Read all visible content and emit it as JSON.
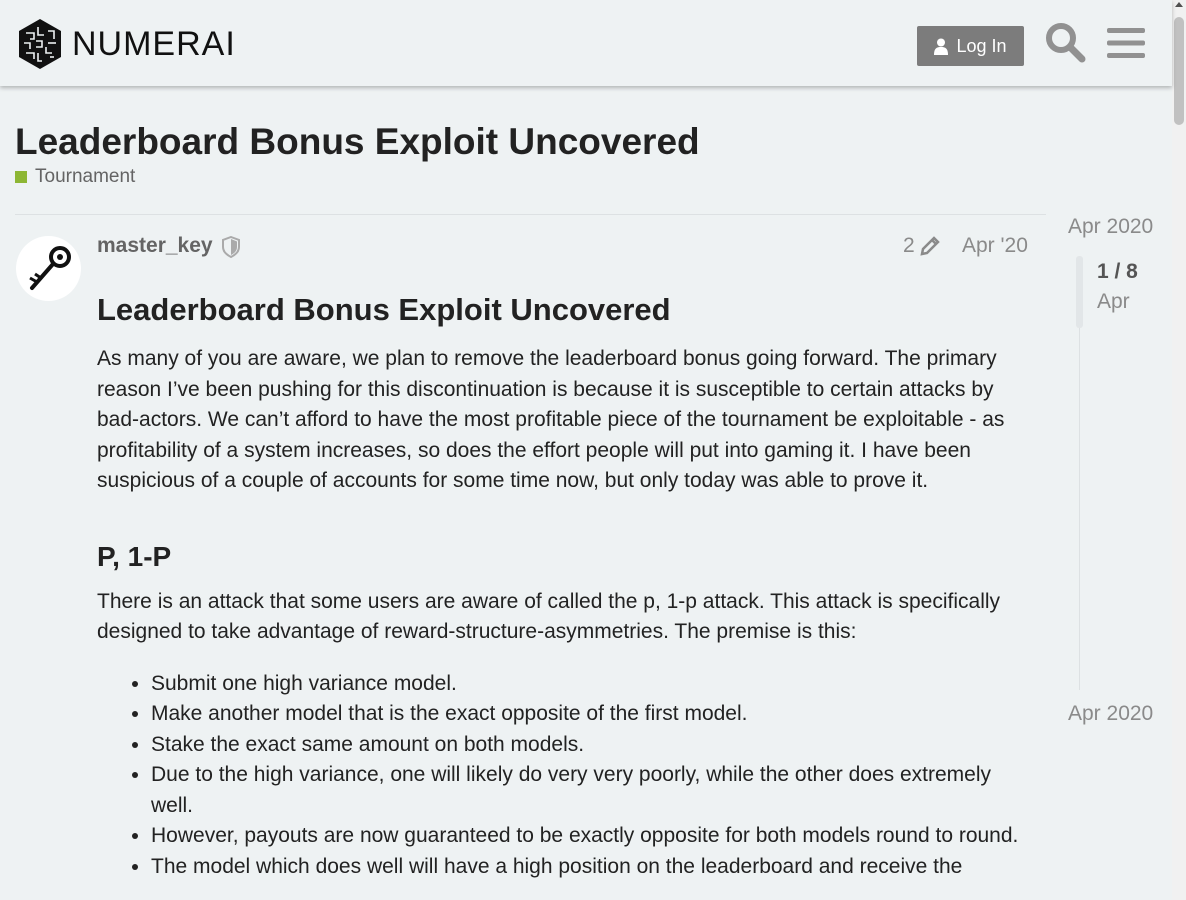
{
  "header": {
    "logo_text": "NUMERAI",
    "login_label": "Log In",
    "icons": [
      "numerai-logo-icon",
      "user-icon",
      "search-icon",
      "hamburger-menu-icon"
    ]
  },
  "topic": {
    "title": "Leaderboard Bonus Exploit Uncovered",
    "category": "Tournament",
    "category_color": "#8db634"
  },
  "post": {
    "username": "master_key",
    "edit_count": "2",
    "date": "Apr '20",
    "heading": "Leaderboard Bonus Exploit Uncovered",
    "intro": "As many of you are aware, we plan to remove the leaderboard bonus going forward. The primary reason I’ve been pushing for this discontinuation is because it is susceptible to certain attacks by bad-actors. We can’t afford to have the most profitable piece of the tournament be exploitable - as profitability of a system increases, so does the effort people will put into gaming it. I have been suspicious of a couple of accounts for some time now, but only today was able to prove it.",
    "section_heading": "P, 1-P",
    "section_text": "There is an attack that some users are aware of called the p, 1-p attack. This attack is specifically designed to take advantage of reward-structure-asymmetries. The premise is this:",
    "list": [
      "Submit one high variance model.",
      "Make another model that is the exact opposite of the first model.",
      "Stake the exact same amount on both models.",
      "Due to the high variance, one will likely do very very poorly, while the other does extremely well.",
      "However, payouts are now guaranteed to be exactly opposite for both models round to round.",
      "The model which does well will have a high position on the leaderboard and receive the"
    ]
  },
  "timeline": {
    "start": "Apr 2020",
    "position": "1 / 8",
    "month": "Apr",
    "end": "Apr 2020"
  }
}
